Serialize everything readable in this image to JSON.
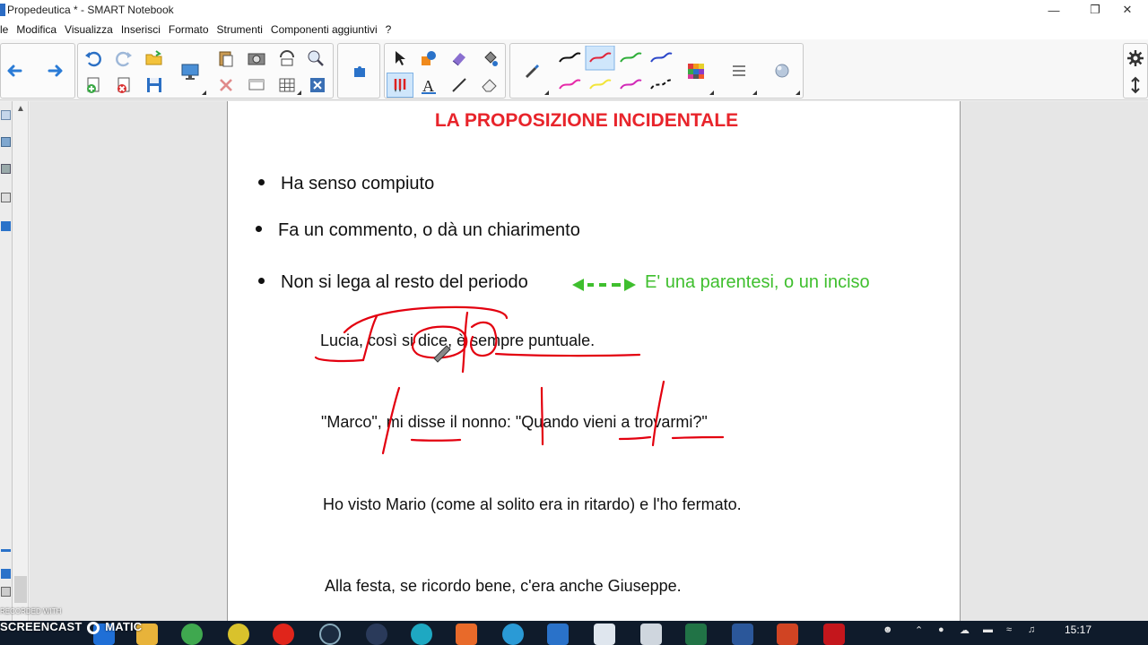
{
  "window": {
    "title": "Propedeutica * - SMART Notebook",
    "controls": {
      "minimize": "—",
      "maximize": "❐",
      "close": "✕"
    }
  },
  "menu": [
    "le",
    "Modifica",
    "Visualizza",
    "Inserisci",
    "Formato",
    "Strumenti",
    "Componenti aggiuntivi",
    "?"
  ],
  "toolbar": {
    "icons": [
      "back-arrow-icon",
      "forward-arrow-icon",
      "undo-icon",
      "redo-icon",
      "open-folder-icon",
      "add-page-icon",
      "delete-page-icon",
      "save-icon",
      "display-icon",
      "paste-icon",
      "screen-capture-icon",
      "clear-icon",
      "rotate-icon",
      "table-icon",
      "properties-icon",
      "add-ons-icon",
      "select-icon",
      "shapes-icon",
      "eraser-icon",
      "fill-icon",
      "pens-icon",
      "text-icon",
      "line-icon",
      "magic-pen-icon",
      "color-palette-icon",
      "line-style-icon",
      "fill-effects-icon",
      "settings-icon",
      "move-toolbar-icon"
    ],
    "pen_colors": [
      "#111111",
      "#e0263b",
      "#2fae3a",
      "#2c47c9",
      "#e62aa8",
      "#f2e53a",
      "#d12ab7",
      "#111111"
    ],
    "active_pen_color": "#e0263b"
  },
  "page": {
    "heading": "LA PROPOSIZIONE INCIDENTALE",
    "bullets": [
      {
        "text": "Ha senso compiuto"
      },
      {
        "text": "Fa un commento, o dà un chiarimento"
      },
      {
        "text": "Non si lega al resto del periodo",
        "note": "E' una parentesi, o un inciso"
      }
    ],
    "examples": [
      "Lucia, così si dice, è sempre puntuale.",
      "\"Marco\", mi disse il nonno: \"Quando vieni a trovarmi?\"",
      "Ho visto Mario (come al solito era in ritardo) e l'ho fermato.",
      "Alla festa, se ricordo bene, c'era anche Giuseppe."
    ],
    "accent_color": "#e8242b",
    "note_color": "#3fbf2e",
    "ink_color": "#e3000f"
  },
  "taskbar": {
    "time": "15:17",
    "watermark_small": "RECORDED WITH",
    "watermark_big": "SCREENCAST",
    "watermark_big_suffix": "MATIC"
  }
}
